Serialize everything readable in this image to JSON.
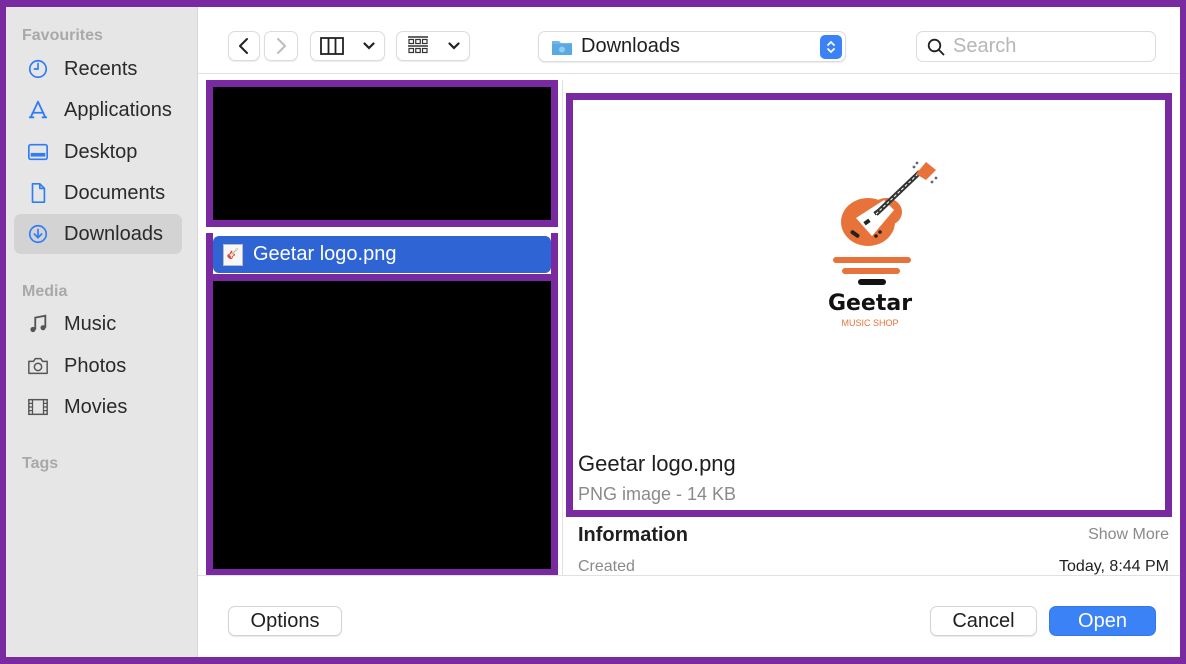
{
  "sidebar": {
    "sections": [
      {
        "title": "Favourites",
        "items": [
          {
            "label": "Recents",
            "icon": "clock-icon"
          },
          {
            "label": "Applications",
            "icon": "applications-icon"
          },
          {
            "label": "Desktop",
            "icon": "desktop-icon"
          },
          {
            "label": "Documents",
            "icon": "document-icon"
          },
          {
            "label": "Downloads",
            "icon": "download-icon",
            "selected": true
          }
        ]
      },
      {
        "title": "Media",
        "items": [
          {
            "label": "Music",
            "icon": "music-note-icon"
          },
          {
            "label": "Photos",
            "icon": "camera-icon"
          },
          {
            "label": "Movies",
            "icon": "film-icon"
          }
        ]
      },
      {
        "title": "Tags",
        "items": []
      }
    ]
  },
  "toolbar": {
    "back": "back-icon",
    "forward": "forward-icon",
    "view_mode": "columns-view-icon",
    "group_mode": "grid-group-icon",
    "location": "Downloads",
    "search_placeholder": "Search",
    "search_value": ""
  },
  "file_list": {
    "selected_file": "Geetar logo.png"
  },
  "preview": {
    "logo_title": "Geetar",
    "logo_subtitle": "MUSIC SHOP",
    "file_name": "Geetar logo.png",
    "file_meta": "PNG image - 14 KB",
    "info_title": "Information",
    "show_more": "Show More",
    "created_label": "Created",
    "created_value": "Today, 8:44 PM"
  },
  "footer": {
    "options": "Options",
    "cancel": "Cancel",
    "open": "Open"
  },
  "colors": {
    "accent": "#3b82f6",
    "selection": "#2f64d5",
    "annotation_border": "#7a2aa0",
    "logo_orange": "#e8733a"
  }
}
